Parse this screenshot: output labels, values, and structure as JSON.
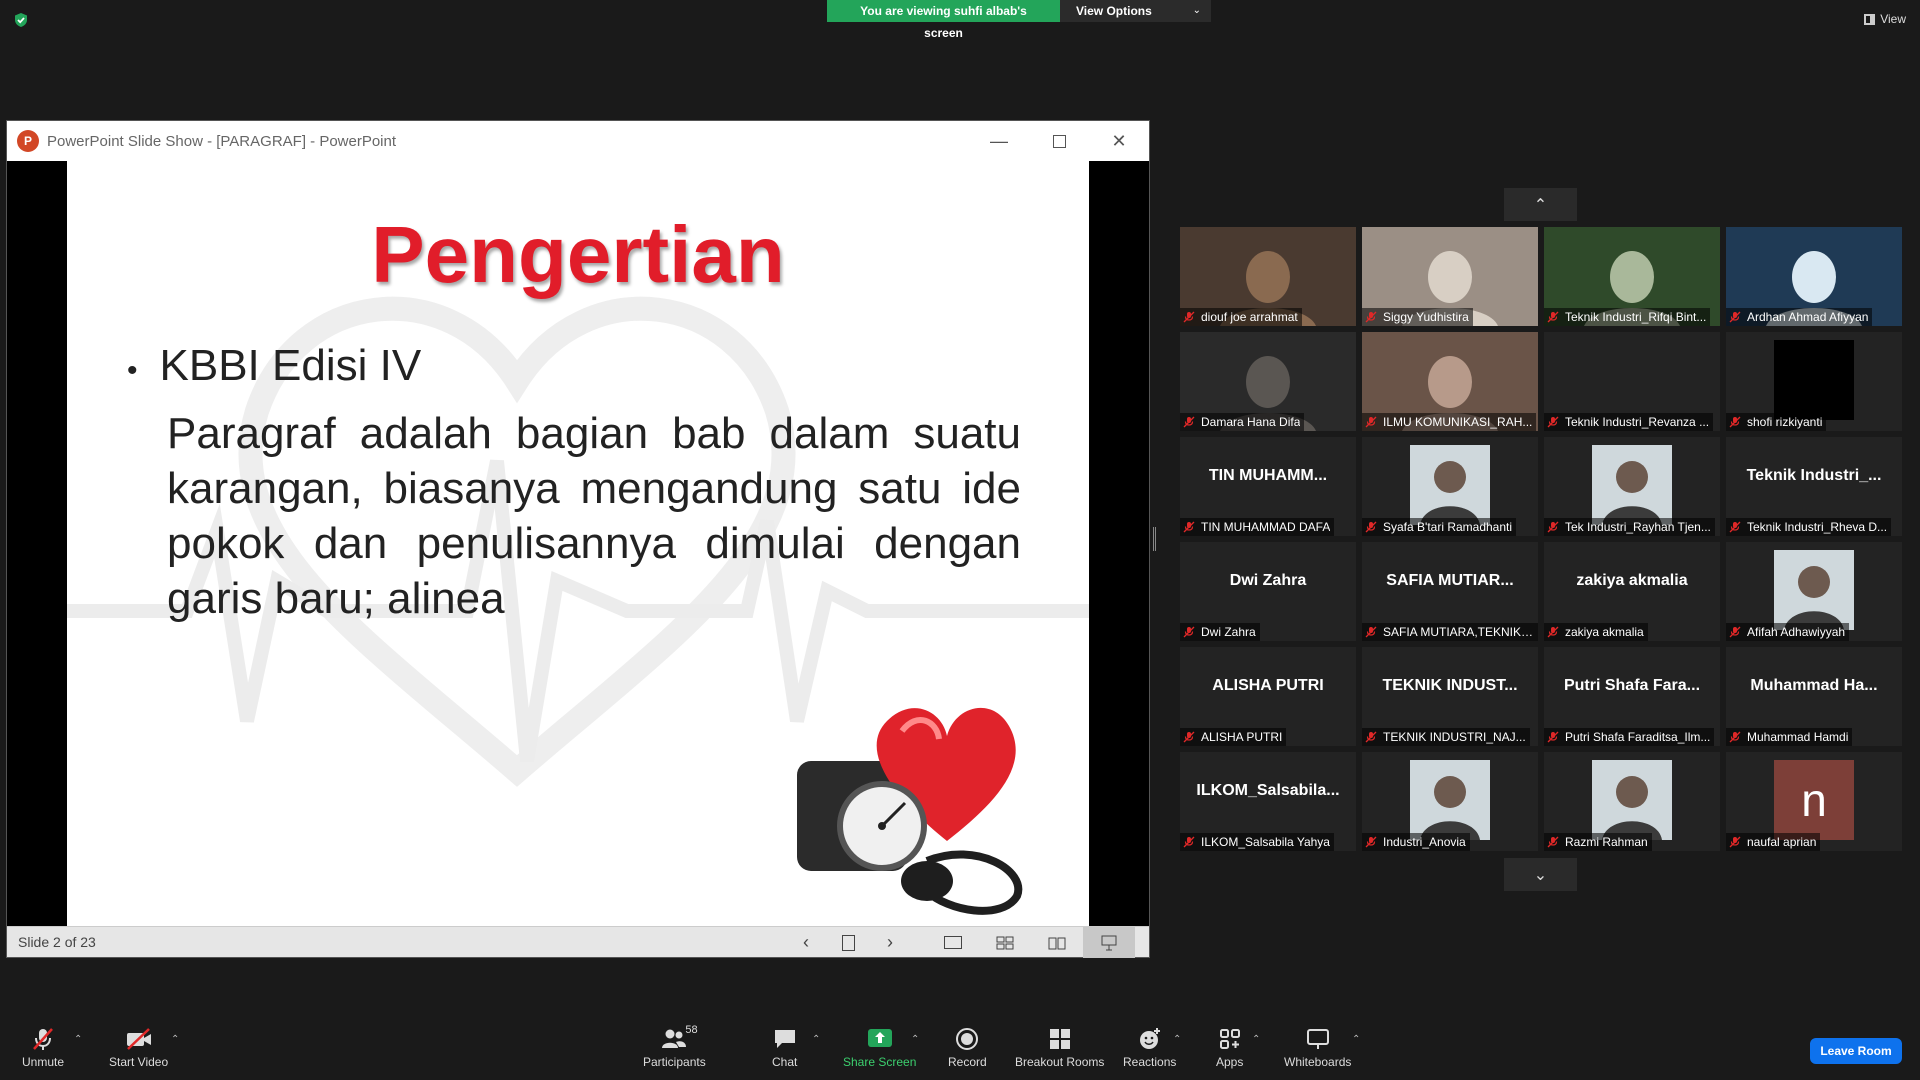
{
  "share_banner": {
    "viewing_text": "You are viewing suhfi albab's screen",
    "view_options": "View Options"
  },
  "view_button": "View",
  "ppt": {
    "window_title": "PowerPoint Slide Show - [PARAGRAF] - PowerPoint",
    "slide_title": "Pengertian",
    "bullet": "KBBI Edisi IV",
    "paragraph": "Paragraf adalah bagian bab dalam suatu karangan, biasanya mengandung satu ide pokok dan penulisannya dimulai dengan garis baru; alinea",
    "status": "Slide 2 of 23"
  },
  "participants": [
    {
      "name": "diouf joe arrahmat",
      "display": "",
      "kind": "video"
    },
    {
      "name": "Siggy Yudhistira",
      "display": "",
      "kind": "video"
    },
    {
      "name": "Teknik Industri_Rifqi Bint...",
      "display": "",
      "kind": "video"
    },
    {
      "name": "Ardhan Ahmad Afiyyan",
      "display": "",
      "kind": "video"
    },
    {
      "name": "Damara Hana Difa",
      "display": "",
      "kind": "video"
    },
    {
      "name": "ILMU KOMUNIKASI_RAH...",
      "display": "",
      "kind": "video"
    },
    {
      "name": "Teknik Industri_Revanza ...",
      "display": "",
      "kind": "blank"
    },
    {
      "name": "shofi rizkiyanti",
      "display": "",
      "kind": "black"
    },
    {
      "name": "TIN MUHAMMAD DAFA",
      "display": "TIN MUHAMM...",
      "kind": "text"
    },
    {
      "name": "Syafa B'tari Ramadhanti",
      "display": "",
      "kind": "photo"
    },
    {
      "name": "Tek Industri_Rayhan Tjen...",
      "display": "",
      "kind": "photo"
    },
    {
      "name": "Teknik Industri_Rheva D...",
      "display": "Teknik Industri_...",
      "kind": "text"
    },
    {
      "name": "Dwi Zahra",
      "display": "Dwi Zahra",
      "kind": "text"
    },
    {
      "name": "SAFIA MUTIARA,TEKNIK ...",
      "display": "SAFIA MUTIAR...",
      "kind": "text"
    },
    {
      "name": "zakiya akmalia",
      "display": "zakiya akmalia",
      "kind": "text"
    },
    {
      "name": "Afifah Adhawiyyah",
      "display": "",
      "kind": "photo"
    },
    {
      "name": "ALISHA PUTRI",
      "display": "ALISHA PUTRI",
      "kind": "text"
    },
    {
      "name": "TEKNIK INDUSTRI_NAJ...",
      "display": "TEKNIK INDUST...",
      "kind": "text"
    },
    {
      "name": "Putri Shafa Faraditsa_Ilm...",
      "display": "Putri Shafa Fara...",
      "kind": "text"
    },
    {
      "name": "Muhammad Hamdi",
      "display": "Muhammad Ha...",
      "kind": "text"
    },
    {
      "name": "ILKOM_Salsabila Yahya",
      "display": "ILKOM_Salsabila...",
      "kind": "text"
    },
    {
      "name": "Industri_Anovia",
      "display": "",
      "kind": "photo"
    },
    {
      "name": "Razmi Rahman",
      "display": "",
      "kind": "photo"
    },
    {
      "name": "naufal aprian",
      "display": "n",
      "kind": "avatar"
    }
  ],
  "toolbar": {
    "unmute": "Unmute",
    "start_video": "Start Video",
    "participants": "Participants",
    "participant_count": "58",
    "chat": "Chat",
    "share_screen": "Share Screen",
    "record": "Record",
    "breakout_rooms": "Breakout Rooms",
    "reactions": "Reactions",
    "apps": "Apps",
    "whiteboards": "Whiteboards",
    "leave": "Leave Room"
  },
  "colors": {
    "share_green": "#23a55a",
    "title_red": "#e11d2a",
    "leave_blue": "#0e72ed",
    "muted_red": "#e02828"
  }
}
